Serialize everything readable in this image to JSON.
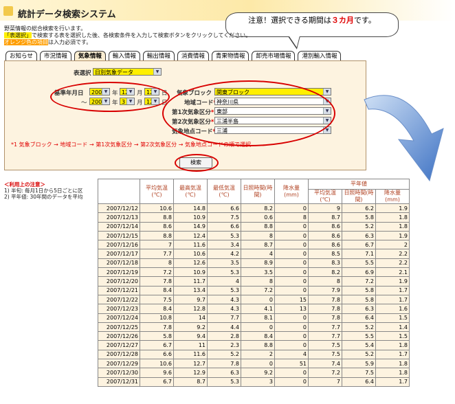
{
  "title": "統計データ検索システム",
  "callout": {
    "prefix": "注意！選択できる期間は",
    "highlight": "３カ月",
    "suffix": "です。"
  },
  "intro": {
    "line1": "野菜情報の総合検索を行います。",
    "line2_a": "「表選択」",
    "line2_b": "で検索する表を選択した後、各検索条件を入力して検索ボタンをクリックしてください。",
    "line3_a": "オレンジ色の項目",
    "line3_b": "は入力必須です。"
  },
  "tabs": [
    "お知らせ",
    "市況情報",
    "気象情報",
    "輸入情報",
    "輸出情報",
    "消費情報",
    "青果物情報",
    "卸売市場情報",
    "港別輸入情報"
  ],
  "active_tab": "気象情報",
  "form": {
    "table_select_label": "表選択",
    "table_select_value": "日別気象データ",
    "base_date_label": "基準年月日",
    "range_sep": "～",
    "from": {
      "year": "2007",
      "month": "12",
      "day": "12"
    },
    "to": {
      "year": "2008",
      "month": "3",
      "day": "12"
    },
    "unit_year": "年",
    "unit_month": "月",
    "unit_day": "日",
    "block_label": "気象ブロック",
    "block_value": "関東ブロック",
    "area_label": "地域コード",
    "area_value": "神奈川県",
    "class1_label": "第1次気象区分",
    "class1_value": "東部",
    "class2_label": "第2次気象区分",
    "class2_value": "三浦半島",
    "point_label": "気象地点コード",
    "point_value": "三浦",
    "required_mark": "*1",
    "note": "*1 気象ブロック → 地域コード → 第1次気象区分 → 第2次気象区分 → 気象地点コードの順で選択",
    "search_button": "検索"
  },
  "notes": {
    "heading": "＜利用上の注意＞",
    "line1": "1) 半旬: 毎月1日から5日ごとに区",
    "line2": "2) 平年値: 30年間のデータを平均"
  },
  "table": {
    "group_header": "平年値",
    "headers": [
      "平均気温(℃)",
      "最高気温(℃)",
      "最低気温(℃)",
      "日照時間(時間)",
      "降水量(mm)"
    ],
    "normal_headers": [
      "平均気温(℃)",
      "日照時間(時間)",
      "降水量(mm)"
    ],
    "rows": [
      [
        "2007/12/12",
        "10.6",
        "14.8",
        "6.6",
        "8.2",
        "0",
        "9",
        "6.2",
        "1.9"
      ],
      [
        "2007/12/13",
        "8.8",
        "10.9",
        "7.5",
        "0.6",
        "8",
        "8.7",
        "5.8",
        "1.8"
      ],
      [
        "2007/12/14",
        "8.6",
        "14.9",
        "6.6",
        "8.8",
        "0",
        "8.6",
        "5.2",
        "1.8"
      ],
      [
        "2007/12/15",
        "8.8",
        "12.4",
        "5.3",
        "8",
        "0",
        "8.6",
        "6.3",
        "1.9"
      ],
      [
        "2007/12/16",
        "7",
        "11.6",
        "3.4",
        "8.7",
        "0",
        "8.6",
        "6.7",
        "2"
      ],
      [
        "2007/12/17",
        "7.7",
        "10.6",
        "4.2",
        "4",
        "0",
        "8.5",
        "7.1",
        "2.2"
      ],
      [
        "2007/12/18",
        "8",
        "12.6",
        "3.5",
        "8.9",
        "0",
        "8.3",
        "5.5",
        "2.2"
      ],
      [
        "2007/12/19",
        "7.2",
        "10.9",
        "5.3",
        "3.5",
        "0",
        "8.2",
        "6.9",
        "2.1"
      ],
      [
        "2007/12/20",
        "7.8",
        "11.7",
        "4",
        "8",
        "0",
        "8",
        "7.2",
        "1.9"
      ],
      [
        "2007/12/21",
        "8.4",
        "13.4",
        "5.3",
        "7.2",
        "0",
        "7.9",
        "5.8",
        "1.7"
      ],
      [
        "2007/12/22",
        "7.5",
        "9.7",
        "4.3",
        "0",
        "15",
        "7.8",
        "5.8",
        "1.7"
      ],
      [
        "2007/12/23",
        "8.4",
        "12.8",
        "4.3",
        "4.1",
        "13",
        "7.8",
        "6.3",
        "1.6"
      ],
      [
        "2007/12/24",
        "10.8",
        "14",
        "7.7",
        "8.1",
        "0",
        "7.8",
        "6.4",
        "1.5"
      ],
      [
        "2007/12/25",
        "7.8",
        "9.2",
        "4.4",
        "0",
        "0",
        "7.7",
        "5.2",
        "1.4"
      ],
      [
        "2007/12/26",
        "5.8",
        "9.4",
        "2.8",
        "8.4",
        "0",
        "7.7",
        "5.5",
        "1.5"
      ],
      [
        "2007/12/27",
        "6.7",
        "11",
        "2.3",
        "8.8",
        "0",
        "7.5",
        "5.4",
        "1.8"
      ],
      [
        "2007/12/28",
        "6.6",
        "11.6",
        "5.2",
        "2",
        "4",
        "7.5",
        "5.2",
        "1.7"
      ],
      [
        "2007/12/29",
        "10.6",
        "12.7",
        "7.8",
        "0",
        "51",
        "7.4",
        "5.9",
        "1.8"
      ],
      [
        "2007/12/30",
        "9.6",
        "12.9",
        "6.3",
        "9.2",
        "0",
        "7.2",
        "7.5",
        "1.8"
      ],
      [
        "2007/12/31",
        "6.7",
        "8.7",
        "5.3",
        "3",
        "0",
        "7",
        "6.4",
        "1.7"
      ]
    ]
  },
  "colors": {
    "accent_red": "#d80000",
    "panel_bg": "#fdf3e0",
    "required_yellow": "#ffef00",
    "arrow_blue": "#5b8ed6"
  }
}
